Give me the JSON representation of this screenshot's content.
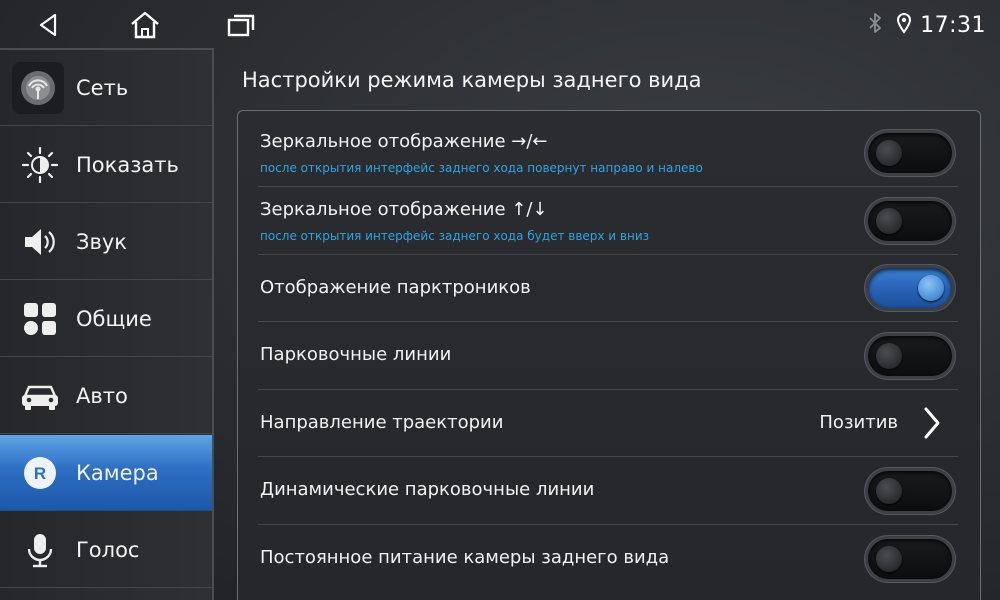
{
  "statusbar": {
    "time": "17:31",
    "icons": [
      "back-icon",
      "home-icon",
      "recent-apps-icon",
      "bluetooth-icon",
      "location-icon"
    ]
  },
  "sidebar": {
    "items": [
      {
        "label": "Сеть",
        "icon": "network-icon",
        "active": false
      },
      {
        "label": "Показать",
        "icon": "brightness-icon",
        "active": false
      },
      {
        "label": "Звук",
        "icon": "speaker-icon",
        "active": false
      },
      {
        "label": "Общие",
        "icon": "grid-icon",
        "active": false
      },
      {
        "label": "Авто",
        "icon": "car-icon",
        "active": false
      },
      {
        "label": "Камера",
        "icon": "camera-r-icon",
        "active": true
      },
      {
        "label": "Голос",
        "icon": "microphone-icon",
        "active": false
      }
    ]
  },
  "main": {
    "title": "Настройки режима камеры заднего вида",
    "settings": [
      {
        "title": "Зеркальное отображение →/←",
        "subtitle": "после открытия интерфейс заднего хода повернут направо и налево",
        "type": "toggle",
        "on": false
      },
      {
        "title": "Зеркальное отображение ↑/↓",
        "subtitle": "после открытия интерфейс заднего хода будет вверх и вниз",
        "type": "toggle",
        "on": false
      },
      {
        "title": "Отображение парктроников",
        "type": "toggle",
        "on": true
      },
      {
        "title": "Парковочные линии",
        "type": "toggle",
        "on": false
      },
      {
        "title": "Направление траектории",
        "type": "select",
        "value": "Позитив"
      },
      {
        "title": "Динамические парковочные линии",
        "type": "toggle",
        "on": false
      },
      {
        "title": "Постоянное питание камеры заднего вида",
        "type": "toggle",
        "on": false
      }
    ]
  },
  "colors": {
    "accent": "#2d6fc4",
    "subtitle": "#2ea3e6",
    "toggle_on": "#3b82d6"
  }
}
